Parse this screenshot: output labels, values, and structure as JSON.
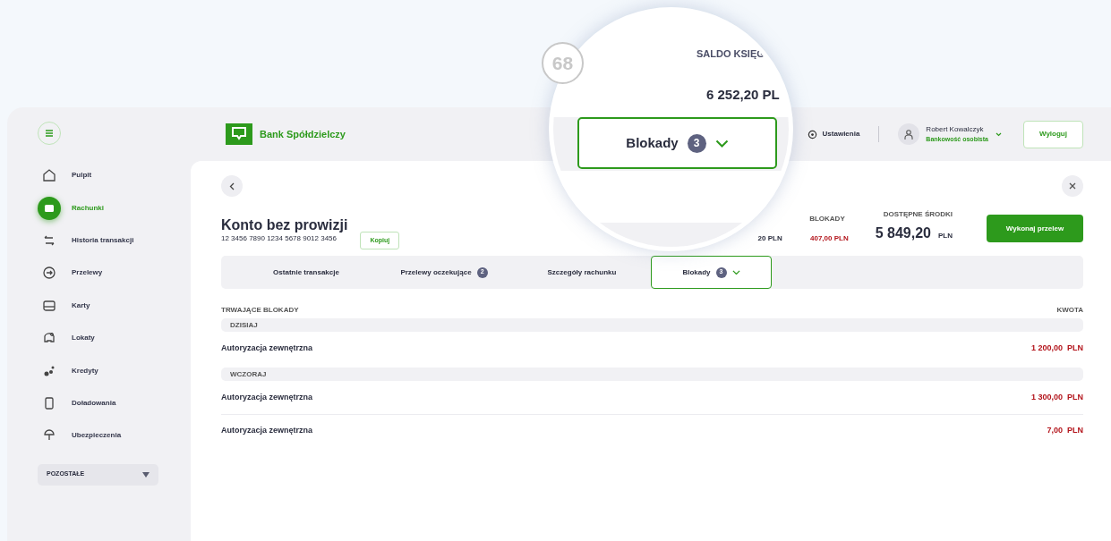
{
  "step_badge": "68",
  "magnifier": {
    "label": "SALDO KSIĘG",
    "amount": "6 252,20 PL",
    "tab": {
      "label": "Blokady",
      "count": "3",
      "expanded": true
    }
  },
  "sidebar": {
    "items": [
      {
        "label": "Pulpit",
        "selected": false
      },
      {
        "label": "Rachunki",
        "selected": true
      },
      {
        "label": "Historia transakcji",
        "selected": false
      },
      {
        "label": "Przelewy",
        "selected": false
      },
      {
        "label": "Karty",
        "selected": false
      },
      {
        "label": "Lokaty",
        "selected": false
      },
      {
        "label": "Kredyty",
        "selected": false
      },
      {
        "label": "Doładowania",
        "selected": false
      },
      {
        "label": "Ubezpieczenia",
        "selected": false
      }
    ],
    "more": "POZOSTAŁE"
  },
  "header": {
    "bank_name": "Bank Spółdzielczy",
    "settings": "Ustawienia",
    "user_name": "Robert Kowalczyk",
    "user_profile": "Bankowość osobista",
    "logout": "Wyloguj"
  },
  "account": {
    "name": "Konto bez prowizji",
    "number": "12 3456 7890 1234 5678 9012 3456",
    "copy": "Kopiuj",
    "partial_amount": "20 PLN",
    "blocks_label": "BLOKADY",
    "blocks_amount": "407,00 PLN",
    "available_label": "DOSTĘPNE ŚRODKI",
    "available_amount": "5 849,20",
    "available_currency": "PLN",
    "transfer_button": "Wykonaj przelew"
  },
  "tabs": [
    {
      "label": "Ostatnie transakcje",
      "selected": false
    },
    {
      "label": "Przelewy oczekujące",
      "count": "2",
      "selected": false
    },
    {
      "label": "Szczegóły rachunku",
      "selected": false
    },
    {
      "label": "Blokady",
      "count": "3",
      "selected": true,
      "expanded": true
    }
  ],
  "table": {
    "columns": [
      "TRWAJĄCE BLOKADY",
      "KWOTA"
    ],
    "groups": [
      {
        "label": "DZISIAJ",
        "rows": [
          {
            "title": "Autoryzacja zewnętrzna",
            "amount": "1 200,00  PLN"
          }
        ]
      },
      {
        "label": "WCZORAJ",
        "rows": [
          {
            "title": "Autoryzacja zewnętrzna",
            "amount": "1 300,00  PLN"
          },
          {
            "title": "Autoryzacja zewnętrzna",
            "amount": "7,00  PLN"
          }
        ]
      }
    ]
  }
}
